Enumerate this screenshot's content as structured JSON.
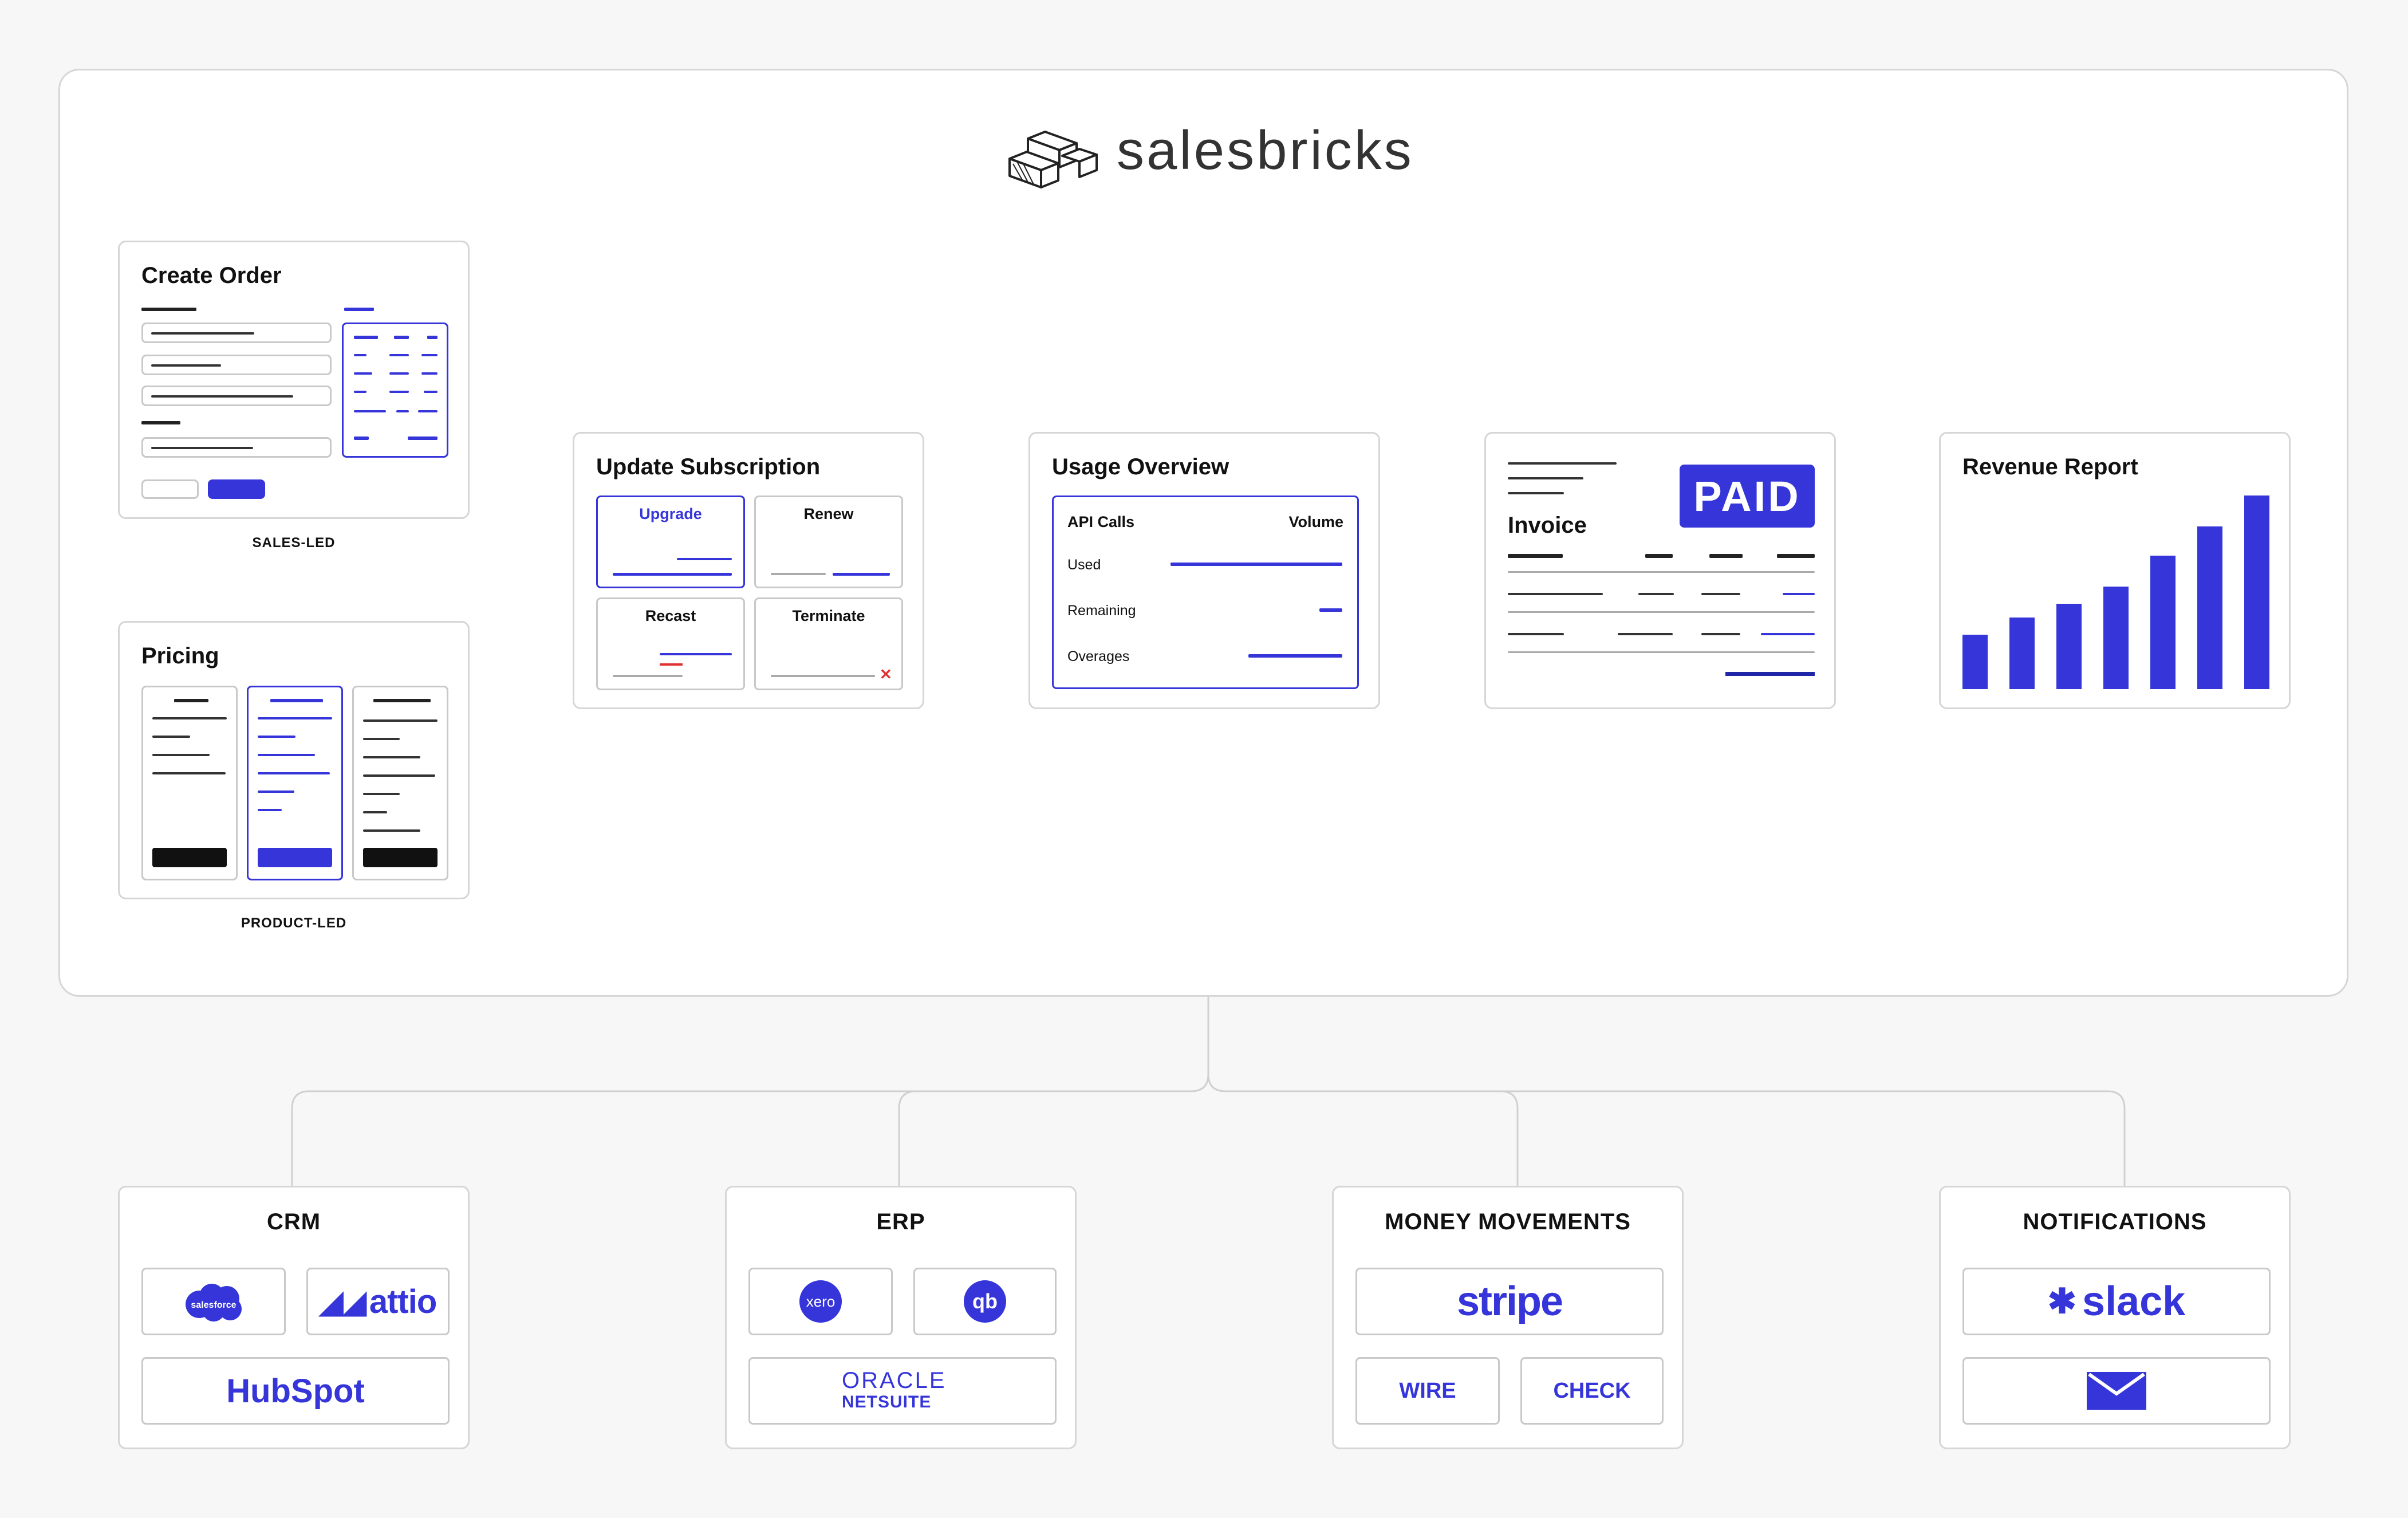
{
  "brand": {
    "name": "salesbricks"
  },
  "create_order": {
    "title": "Create Order",
    "caption": "SALES-LED"
  },
  "pricing": {
    "title": "Pricing",
    "caption": "PRODUCT-LED"
  },
  "update_subscription": {
    "title": "Update Subscription",
    "options": [
      "Upgrade",
      "Renew",
      "Recast",
      "Terminate"
    ]
  },
  "usage_overview": {
    "title": "Usage Overview",
    "header": {
      "left": "API Calls",
      "right": "Volume"
    },
    "rows": [
      "Used",
      "Remaining",
      "Overages"
    ]
  },
  "invoice": {
    "title": "Invoice",
    "badge": "PAID"
  },
  "revenue_report": {
    "title": "Revenue Report",
    "bar_levels": [
      0.28,
      0.37,
      0.44,
      0.53,
      0.69,
      0.84,
      1.0
    ]
  },
  "integrations": [
    {
      "title": "CRM",
      "logos": [
        "salesforce",
        "attio",
        "HubSpot"
      ]
    },
    {
      "title": "ERP",
      "logos": [
        "xero",
        "qb",
        "ORACLE",
        "NETSUITE"
      ]
    },
    {
      "title": "MONEY MOVEMENTS",
      "logos": [
        "stripe",
        "WIRE",
        "CHECK"
      ]
    },
    {
      "title": "NOTIFICATIONS",
      "logos": [
        "slack",
        "email-icon"
      ]
    }
  ],
  "colors": {
    "accent": "#3535d9",
    "line": "#d6d6d6",
    "danger": "#e03030"
  }
}
